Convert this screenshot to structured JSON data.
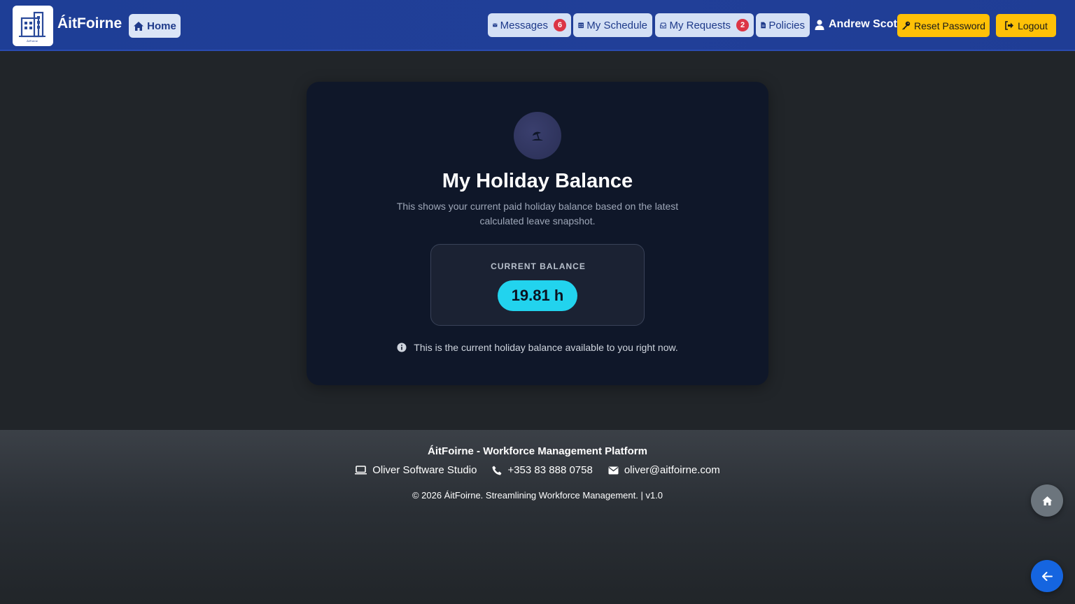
{
  "brand": {
    "name": "ÁitFoirne",
    "logo_icon": "building-icon",
    "logo_caption": "ÁitFoirne"
  },
  "nav": {
    "home": "Home",
    "messages": {
      "label": "Messages",
      "badge": "6"
    },
    "schedule": "My Schedule",
    "requests": {
      "label": "My Requests",
      "badge": "2"
    },
    "policies": "Policies",
    "user": "Andrew Scott",
    "reset_password": "Reset Password",
    "logout": "Logout"
  },
  "card": {
    "icon": "umbrella-beach-icon",
    "title": "My Holiday Balance",
    "description": "This shows your current paid holiday balance based on the latest calculated leave snapshot.",
    "balance_label": "CURRENT BALANCE",
    "balance_value": "19.81 h",
    "note": "This is the current holiday balance available to you right now."
  },
  "footer": {
    "title": "ÁitFoirne - Workforce Management Platform",
    "company": "Oliver Software Studio",
    "phone": "+353 83 888 0758",
    "email": "oliver@aitfoirne.com",
    "copyright": "© 2026 ÁitFoirne. Streamlining Workforce Management. | v1.0"
  },
  "colors": {
    "navbar": "#1e3e96",
    "accent_cyan": "#22d3ee",
    "warning": "#ffc107",
    "danger": "#dc3545",
    "back_button": "#1565e0"
  }
}
